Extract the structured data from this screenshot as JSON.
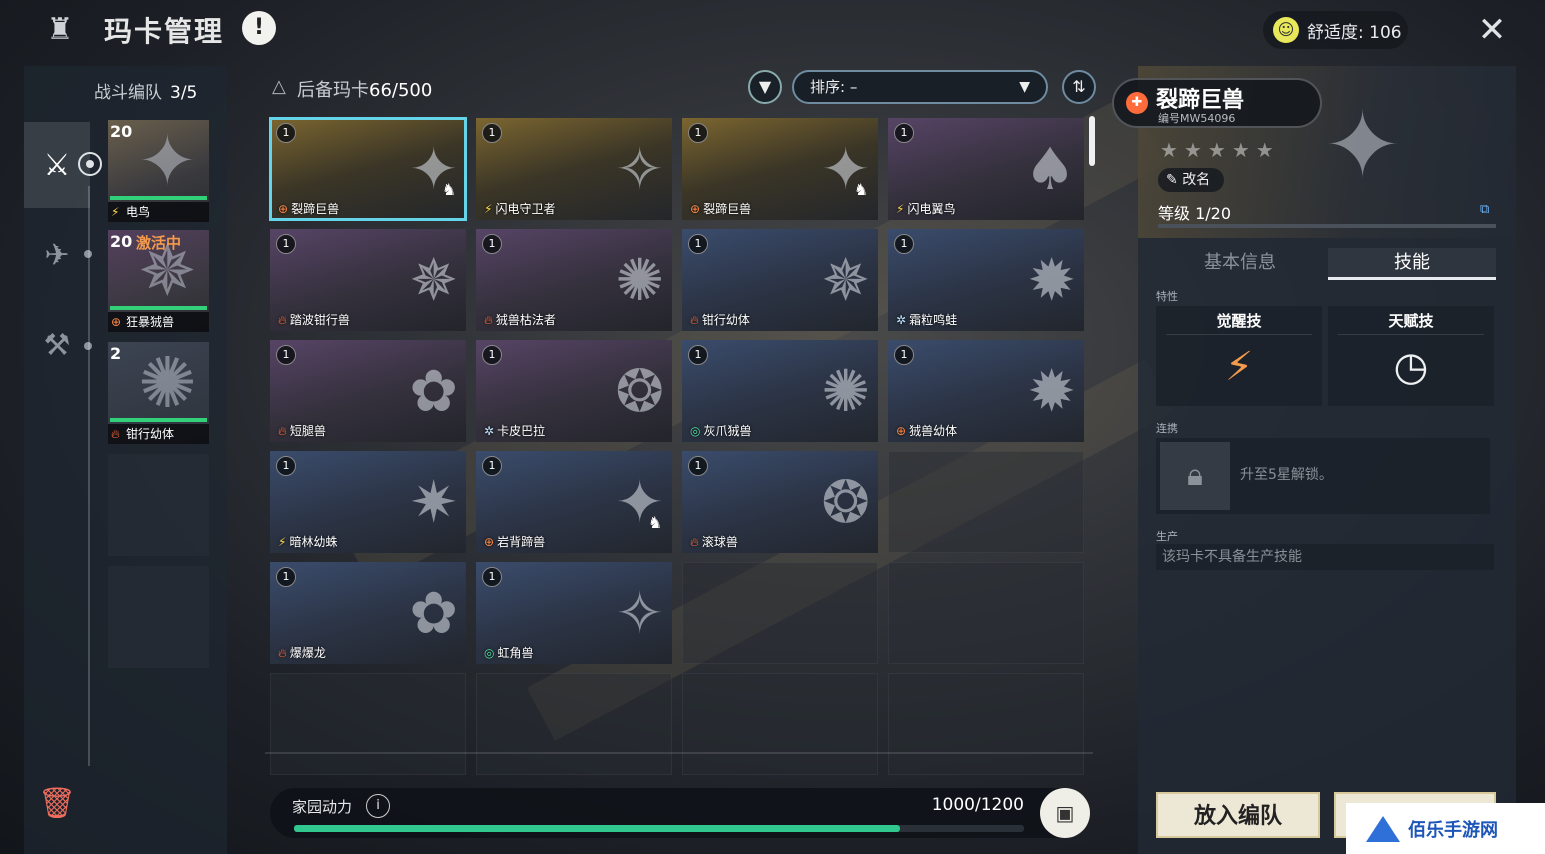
{
  "header": {
    "title": "玛卡管理",
    "alert": "!",
    "comfort_label": "舒适度: 106"
  },
  "team": {
    "label": "战斗编队",
    "count": "3/5",
    "slots": [
      {
        "level": "20",
        "status": "",
        "name": "电鸟",
        "element": "bolt",
        "hp": 1.0
      },
      {
        "level": "20",
        "status": "激活中",
        "name": "狂暴狨兽",
        "element": "earth",
        "hp": 1.0
      },
      {
        "level": "2",
        "status": "",
        "name": "钳行幼体",
        "element": "fire",
        "hp": 1.0
      }
    ]
  },
  "list": {
    "label": "后备玛卡",
    "count": "66/500",
    "sort_label": "排序: –",
    "cards": [
      {
        "count": "1",
        "name": "裂蹄巨兽",
        "element": "earth",
        "rarity": "gold",
        "mountable": true,
        "selected": true
      },
      {
        "count": "1",
        "name": "闪电守卫者",
        "element": "bolt",
        "rarity": "gold",
        "mountable": false
      },
      {
        "count": "1",
        "name": "裂蹄巨兽",
        "element": "earth",
        "rarity": "gold",
        "mountable": true
      },
      {
        "count": "1",
        "name": "闪电翼鸟",
        "element": "bolt",
        "rarity": "purple",
        "mountable": false
      },
      {
        "count": "1",
        "name": "踏波钳行兽",
        "element": "fire",
        "rarity": "purple",
        "mountable": false
      },
      {
        "count": "1",
        "name": "狨兽枯法者",
        "element": "fire",
        "rarity": "purple",
        "mountable": false
      },
      {
        "count": "1",
        "name": "钳行幼体",
        "element": "fire",
        "rarity": "blue",
        "mountable": false
      },
      {
        "count": "1",
        "name": "霜粒鸣蛙",
        "element": "ice",
        "rarity": "blue",
        "mountable": false
      },
      {
        "count": "1",
        "name": "短腿兽",
        "element": "fire",
        "rarity": "purple",
        "mountable": false
      },
      {
        "count": "1",
        "name": "卡皮巴拉",
        "element": "ice",
        "rarity": "purple",
        "mountable": false
      },
      {
        "count": "1",
        "name": "灰爪狨兽",
        "element": "wind",
        "rarity": "blue",
        "mountable": false
      },
      {
        "count": "1",
        "name": "狨兽幼体",
        "element": "earth",
        "rarity": "blue",
        "mountable": false
      },
      {
        "count": "1",
        "name": "暗林幼蛛",
        "element": "bolt",
        "rarity": "blue",
        "mountable": false
      },
      {
        "count": "1",
        "name": "岩背蹄兽",
        "element": "earth",
        "rarity": "blue",
        "mountable": true
      },
      {
        "count": "1",
        "name": "滚球兽",
        "element": "fire",
        "rarity": "blue",
        "mountable": false
      },
      {
        "count": "1",
        "name": "爆爆龙",
        "element": "fire",
        "rarity": "blue",
        "mountable": false
      },
      {
        "count": "1",
        "name": "虹角兽",
        "element": "wind",
        "rarity": "blue",
        "mountable": false
      }
    ]
  },
  "power": {
    "label": "家园动力",
    "value_text": "1000/1200",
    "fraction": 0.83
  },
  "detail": {
    "name": "裂蹄巨兽",
    "id_text": "编号MW54096",
    "stars": 5,
    "rename": "改名",
    "level_text": "等级 1/20",
    "tab_basic": "基本信息",
    "tab_skill": "技能",
    "trait_label": "特性",
    "awaken_label": "觉醒技",
    "talent_label": "天赋技",
    "link_label": "连携",
    "link_text": "升至5星解锁。",
    "prod_label": "生产",
    "prod_text": "该玛卡不具备生产技能",
    "place_button": "放入编队"
  },
  "watermark": "佰乐手游网",
  "colors": {
    "accent": "#66d4e8",
    "power": "#31c890",
    "active": "#f39a4c"
  }
}
